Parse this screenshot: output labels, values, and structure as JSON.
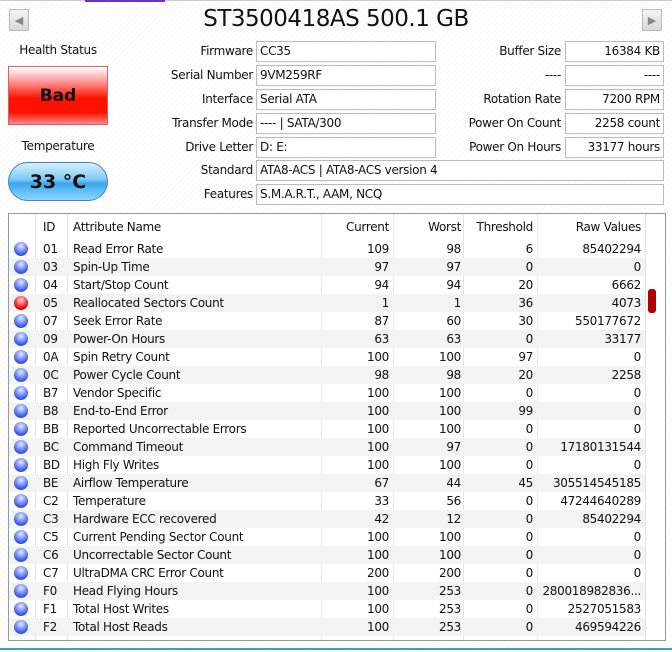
{
  "title": "ST3500418AS 500.1 GB",
  "health": {
    "label": "Health Status",
    "value": "Bad",
    "color": "#ff1100"
  },
  "temperature": {
    "label": "Temperature",
    "value": "33 °C",
    "color": "#3aa8ee"
  },
  "fields_left": [
    {
      "label": "Firmware",
      "value": "CC35"
    },
    {
      "label": "Serial Number",
      "value": "9VM259RF"
    },
    {
      "label": "Interface",
      "value": "Serial ATA"
    },
    {
      "label": "Transfer Mode",
      "value": "---- | SATA/300"
    },
    {
      "label": "Drive Letter",
      "value": "D: E:"
    }
  ],
  "fields_right": [
    {
      "label": "Buffer Size",
      "value": "16384 KB"
    },
    {
      "label": "----",
      "value": "----"
    },
    {
      "label": "Rotation Rate",
      "value": "7200 RPM"
    },
    {
      "label": "Power On Count",
      "value": "2258 count"
    },
    {
      "label": "Power On Hours",
      "value": "33177 hours"
    }
  ],
  "standard": {
    "label": "Standard",
    "value": "ATA8-ACS | ATA8-ACS version 4"
  },
  "features": {
    "label": "Features",
    "value": "S.M.A.R.T., AAM, NCQ"
  },
  "table": {
    "headers": {
      "id": "ID",
      "name": "Attribute Name",
      "current": "Current",
      "worst": "Worst",
      "threshold": "Threshold",
      "raw": "Raw Values"
    },
    "rows": [
      {
        "status": "ok",
        "id": "01",
        "name": "Read Error Rate",
        "current": "109",
        "worst": "98",
        "threshold": "6",
        "raw": "85402294"
      },
      {
        "status": "ok",
        "id": "03",
        "name": "Spin-Up Time",
        "current": "97",
        "worst": "97",
        "threshold": "0",
        "raw": "0"
      },
      {
        "status": "ok",
        "id": "04",
        "name": "Start/Stop Count",
        "current": "94",
        "worst": "94",
        "threshold": "20",
        "raw": "6662"
      },
      {
        "status": "bad",
        "id": "05",
        "name": "Reallocated Sectors Count",
        "current": "1",
        "worst": "1",
        "threshold": "36",
        "raw": "4073"
      },
      {
        "status": "ok",
        "id": "07",
        "name": "Seek Error Rate",
        "current": "87",
        "worst": "60",
        "threshold": "30",
        "raw": "550177672"
      },
      {
        "status": "ok",
        "id": "09",
        "name": "Power-On Hours",
        "current": "63",
        "worst": "63",
        "threshold": "0",
        "raw": "33177"
      },
      {
        "status": "ok",
        "id": "0A",
        "name": "Spin Retry Count",
        "current": "100",
        "worst": "100",
        "threshold": "97",
        "raw": "0"
      },
      {
        "status": "ok",
        "id": "0C",
        "name": "Power Cycle Count",
        "current": "98",
        "worst": "98",
        "threshold": "20",
        "raw": "2258"
      },
      {
        "status": "ok",
        "id": "B7",
        "name": "Vendor Specific",
        "current": "100",
        "worst": "100",
        "threshold": "0",
        "raw": "0"
      },
      {
        "status": "ok",
        "id": "B8",
        "name": "End-to-End Error",
        "current": "100",
        "worst": "100",
        "threshold": "99",
        "raw": "0"
      },
      {
        "status": "ok",
        "id": "BB",
        "name": "Reported Uncorrectable Errors",
        "current": "100",
        "worst": "100",
        "threshold": "0",
        "raw": "0"
      },
      {
        "status": "ok",
        "id": "BC",
        "name": "Command Timeout",
        "current": "100",
        "worst": "97",
        "threshold": "0",
        "raw": "17180131544"
      },
      {
        "status": "ok",
        "id": "BD",
        "name": "High Fly Writes",
        "current": "100",
        "worst": "100",
        "threshold": "0",
        "raw": "0"
      },
      {
        "status": "ok",
        "id": "BE",
        "name": "Airflow Temperature",
        "current": "67",
        "worst": "44",
        "threshold": "45",
        "raw": "305514545185"
      },
      {
        "status": "ok",
        "id": "C2",
        "name": "Temperature",
        "current": "33",
        "worst": "56",
        "threshold": "0",
        "raw": "47244640289"
      },
      {
        "status": "ok",
        "id": "C3",
        "name": "Hardware ECC recovered",
        "current": "42",
        "worst": "12",
        "threshold": "0",
        "raw": "85402294"
      },
      {
        "status": "ok",
        "id": "C5",
        "name": "Current Pending Sector Count",
        "current": "100",
        "worst": "100",
        "threshold": "0",
        "raw": "0"
      },
      {
        "status": "ok",
        "id": "C6",
        "name": "Uncorrectable Sector Count",
        "current": "100",
        "worst": "100",
        "threshold": "0",
        "raw": "0"
      },
      {
        "status": "ok",
        "id": "C7",
        "name": "UltraDMA CRC Error Count",
        "current": "200",
        "worst": "200",
        "threshold": "0",
        "raw": "0"
      },
      {
        "status": "ok",
        "id": "F0",
        "name": "Head Flying Hours",
        "current": "100",
        "worst": "253",
        "threshold": "0",
        "raw": "280018982836..."
      },
      {
        "status": "ok",
        "id": "F1",
        "name": "Total Host Writes",
        "current": "100",
        "worst": "253",
        "threshold": "0",
        "raw": "2527051583"
      },
      {
        "status": "ok",
        "id": "F2",
        "name": "Total Host Reads",
        "current": "100",
        "worst": "253",
        "threshold": "0",
        "raw": "469594226"
      }
    ]
  }
}
